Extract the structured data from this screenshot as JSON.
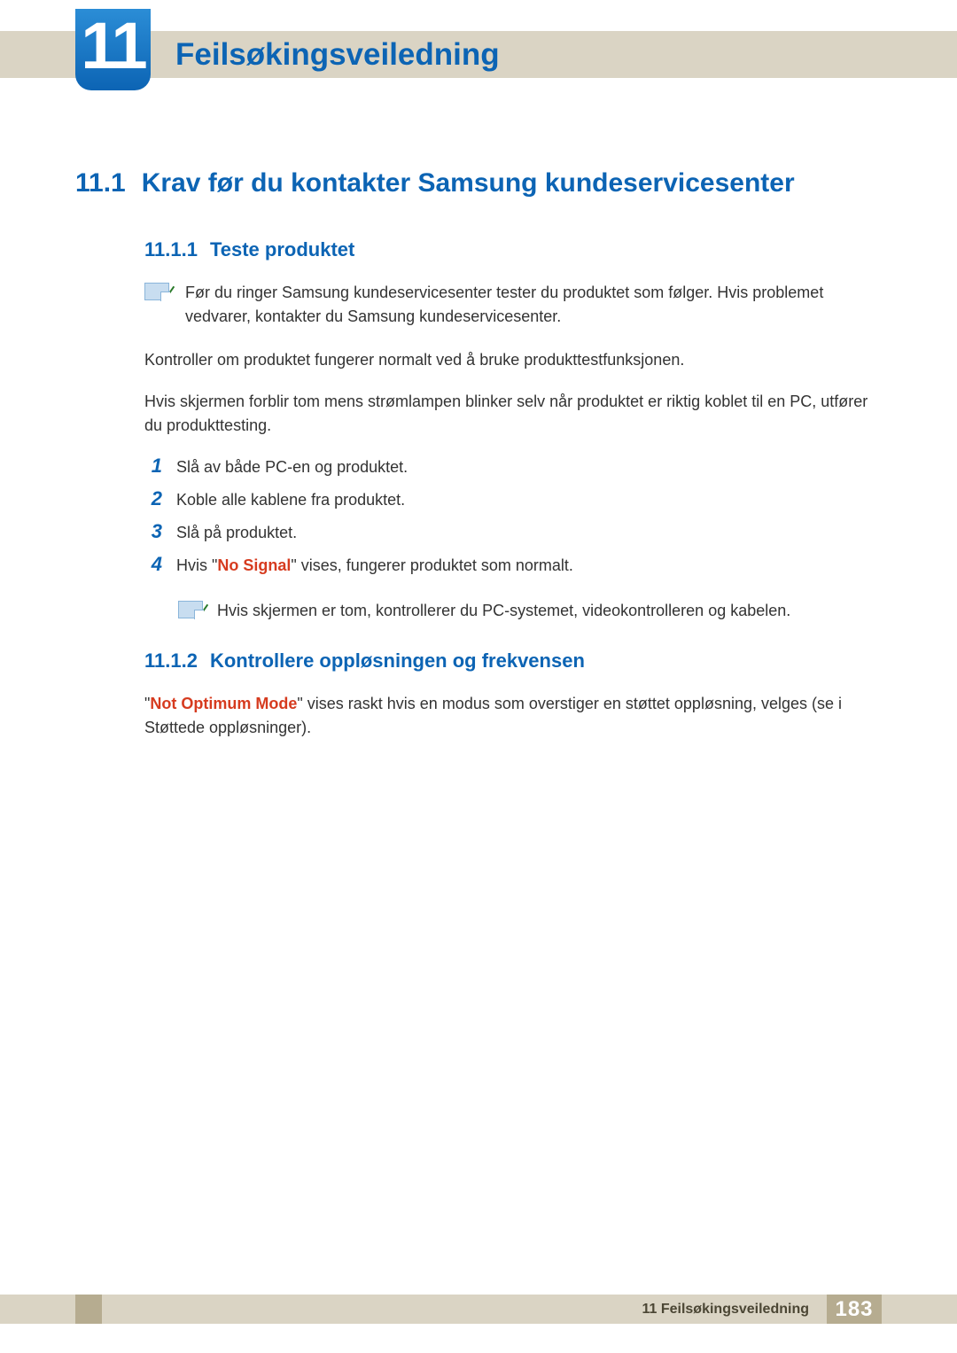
{
  "chapter": {
    "number": "11",
    "title": "Feilsøkingsveiledning"
  },
  "section": {
    "number": "11.1",
    "title": "Krav før du kontakter Samsung kundeservicesenter"
  },
  "subsection1": {
    "number": "11.1.1",
    "title": "Teste produktet",
    "note": "Før du ringer Samsung kundeservicesenter tester du produktet som følger. Hvis problemet vedvarer, kontakter du Samsung kundeservicesenter.",
    "para1": "Kontroller om produktet fungerer normalt ved å bruke produkttestfunksjonen.",
    "para2": "Hvis skjermen forblir tom mens strømlampen blinker selv når produktet er riktig koblet til en PC, utfører du produkttesting.",
    "steps": [
      {
        "n": "1",
        "text": "Slå av både PC-en og produktet."
      },
      {
        "n": "2",
        "text": "Koble alle kablene fra produktet."
      },
      {
        "n": "3",
        "text": "Slå på produktet."
      },
      {
        "n": "4",
        "prefix": "Hvis \"",
        "highlight": "No Signal",
        "suffix": "\" vises, fungerer produktet som normalt."
      }
    ],
    "subnote": "Hvis skjermen er tom, kontrollerer du PC-systemet, videokontrolleren og kabelen."
  },
  "subsection2": {
    "number": "11.1.2",
    "title": "Kontrollere oppløsningen og frekvensen",
    "body_prefix": "\"",
    "body_highlight": "Not Optimum Mode",
    "body_suffix": "\" vises raskt hvis en modus som overstiger en støttet oppløsning, velges (se i Støttede oppløsninger)."
  },
  "footer": {
    "chapter_label": "11 Feilsøkingsveiledning",
    "page": "183"
  }
}
